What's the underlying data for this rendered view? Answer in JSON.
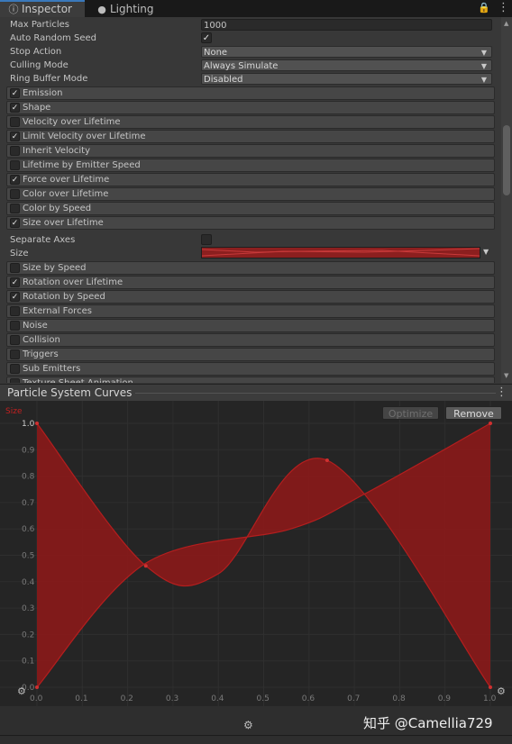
{
  "tabs": {
    "inspector": {
      "label": "Inspector",
      "icon": "info-icon"
    },
    "lighting": {
      "label": "Lighting",
      "icon": "lightbulb-icon"
    }
  },
  "props": {
    "max_particles": {
      "label": "Max Particles",
      "value": "1000"
    },
    "auto_random_seed": {
      "label": "Auto Random Seed",
      "checked": true
    },
    "stop_action": {
      "label": "Stop Action",
      "value": "None"
    },
    "culling_mode": {
      "label": "Culling Mode",
      "value": "Always Simulate"
    },
    "ring_buffer_mode": {
      "label": "Ring Buffer Mode",
      "value": "Disabled"
    },
    "separate_axes": {
      "label": "Separate Axes",
      "checked": false
    },
    "size": {
      "label": "Size"
    }
  },
  "modules_top": [
    {
      "label": "Emission",
      "checked": true
    },
    {
      "label": "Shape",
      "checked": true
    },
    {
      "label": "Velocity over Lifetime",
      "checked": false
    },
    {
      "label": "Limit Velocity over Lifetime",
      "checked": true
    },
    {
      "label": "Inherit Velocity",
      "checked": false
    },
    {
      "label": "Lifetime by Emitter Speed",
      "checked": false
    },
    {
      "label": "Force over Lifetime",
      "checked": true
    },
    {
      "label": "Color over Lifetime",
      "checked": false
    },
    {
      "label": "Color by Speed",
      "checked": false
    },
    {
      "label": "Size over Lifetime",
      "checked": true
    }
  ],
  "modules_bottom": [
    {
      "label": "Size by Speed",
      "checked": false
    },
    {
      "label": "Rotation over Lifetime",
      "checked": true
    },
    {
      "label": "Rotation by Speed",
      "checked": true
    },
    {
      "label": "External Forces",
      "checked": false
    },
    {
      "label": "Noise",
      "checked": false
    },
    {
      "label": "Collision",
      "checked": false
    },
    {
      "label": "Triggers",
      "checked": false
    },
    {
      "label": "Sub Emitters",
      "checked": false
    },
    {
      "label": "Texture Sheet Animation",
      "checked": false
    }
  ],
  "curves_panel": {
    "title": "Particle System Curves",
    "optimize_label": "Optimize",
    "remove_label": "Remove",
    "size_tag": "Size"
  },
  "watermark": "知乎 @Camellia729",
  "chart_data": {
    "type": "area",
    "x_ticks": [
      "0.0",
      "0.1",
      "0.2",
      "0.3",
      "0.4",
      "0.5",
      "0.6",
      "0.7",
      "0.8",
      "0.9",
      "1.0"
    ],
    "y_ticks": [
      "0.0",
      "0.1",
      "0.2",
      "0.3",
      "0.4",
      "0.5",
      "0.6",
      "0.7",
      "0.8",
      "0.9",
      "1.0"
    ],
    "xlim": [
      0,
      1.05
    ],
    "ylim": [
      0,
      1.0
    ],
    "series": [
      {
        "keys": [
          [
            0.0,
            1.0
          ],
          [
            0.24,
            0.46
          ],
          [
            0.4,
            0.43
          ],
          [
            0.64,
            0.86
          ],
          [
            1.0,
            0.0
          ]
        ]
      },
      {
        "keys": [
          [
            0.0,
            0.0
          ],
          [
            0.24,
            0.47
          ],
          [
            0.56,
            0.6
          ],
          [
            0.72,
            0.73
          ],
          [
            1.0,
            1.0
          ]
        ]
      }
    ],
    "colors": {
      "fill": "#8b1a1a",
      "stroke": "#b41e1e",
      "grid": "#2f2f2f",
      "tick": "#7a7a7a"
    }
  }
}
